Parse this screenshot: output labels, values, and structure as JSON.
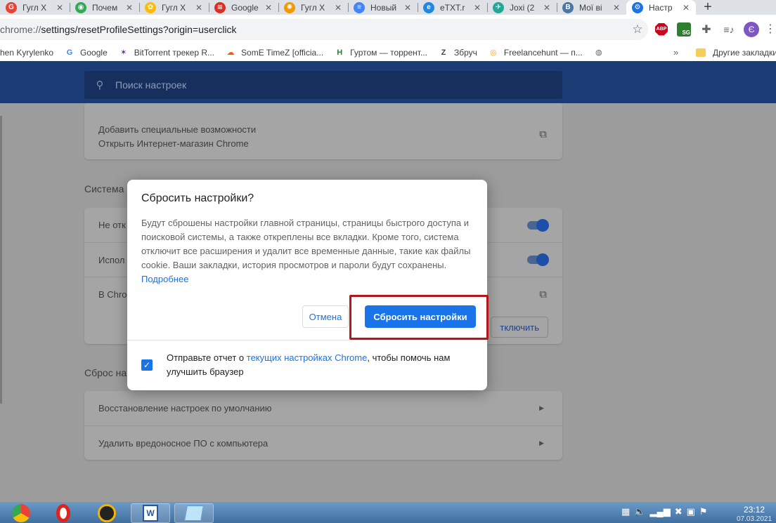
{
  "tabs": [
    {
      "title": "Гугл Х",
      "icon": "google-tab-icon",
      "color": "#ea4335",
      "glyph": "G"
    },
    {
      "title": "Почем",
      "icon": "chrome-tab-icon",
      "color": "#34a853",
      "glyph": "◉"
    },
    {
      "title": "Гугл Х",
      "icon": "google-photos-tab-icon",
      "color": "#fbbc05",
      "glyph": "✿"
    },
    {
      "title": "Google",
      "icon": "wifi-tab-icon",
      "color": "#d93025",
      "glyph": "≋"
    },
    {
      "title": "Гугл Х",
      "icon": "orange-tab-icon",
      "color": "#f29900",
      "glyph": "✺"
    },
    {
      "title": "Новый",
      "icon": "docs-tab-icon",
      "color": "#4285f4",
      "glyph": "≡"
    },
    {
      "title": "eTXT.r",
      "icon": "etxt-tab-icon",
      "color": "#1e88e5",
      "glyph": "e"
    },
    {
      "title": "Joxi (2",
      "icon": "joxi-tab-icon",
      "color": "#26a69a",
      "glyph": "✈"
    },
    {
      "title": "Мої ві",
      "icon": "vk-tab-icon",
      "color": "#4a76a8",
      "glyph": "В"
    },
    {
      "title": "Настр",
      "icon": "settings-gear-tab-icon",
      "color": "#1a73e8",
      "glyph": "⚙",
      "active": true
    }
  ],
  "omnibox": {
    "url_prefix": "chrome://",
    "url_rest": "settings/resetProfileSettings?origin=userclick"
  },
  "toolbar": {
    "avatar_letter": "Є",
    "abp": "ABP",
    "sg": "SG"
  },
  "bookmarks": [
    {
      "label": "hen Kyrylenko",
      "icon": "",
      "color": "#ffffff"
    },
    {
      "label": "Google",
      "icon": "google-bookmark-icon",
      "color": "#4285f4",
      "glyph": "G"
    },
    {
      "label": "BitTorrent трекер R...",
      "icon": "bittorrent-bookmark-icon",
      "color": "#7b1fa2",
      "glyph": "✶"
    },
    {
      "label": "SomE TimeZ [officia...",
      "icon": "soundcloud-bookmark-icon",
      "color": "#ff5500",
      "glyph": "☁"
    },
    {
      "label": "Гуртом — торрент...",
      "icon": "hurtom-bookmark-icon",
      "color": "#2e7d32",
      "glyph": "H"
    },
    {
      "label": "Збруч",
      "icon": "zbruch-bookmark-icon",
      "color": "#37474f",
      "glyph": "Z"
    },
    {
      "label": "Freelancehunt — п...",
      "icon": "freelancehunt-bookmark-icon",
      "color": "#f9a825",
      "glyph": "◎"
    },
    {
      "label": "",
      "icon": "globe-bookmark-icon",
      "color": "#5f6368",
      "glyph": "◍"
    }
  ],
  "bookmarks_more": "»",
  "other_bookmarks": "Другие закладки",
  "search": {
    "placeholder": "Поиск настроек"
  },
  "page": {
    "accessibility_title": "Добавить специальные возможности",
    "accessibility_sub": "Открыть Интернет-магазин Chrome",
    "system_section": "Система",
    "system_row1": "Не отк",
    "system_row2": "Испол",
    "system_row3": "В Chro",
    "disable_btn": "тключить",
    "reset_section": "Сброс на",
    "reset_row1": "Восстановление настроек по умолчанию",
    "reset_row2": "Удалить вредоносное ПО с компьютера"
  },
  "dialog": {
    "title": "Сбросить настройки?",
    "body": "Будут сброшены настройки главной страницы, страницы быстрого доступа и поисковой системы, а также откреплены все вкладки. Кроме того, система отключит все расширения и удалит все временные данные, такие как файлы cookie. Ваши закладки, история просмотров и пароли будут сохранены.",
    "learn_more": "Подробнее",
    "cancel": "Отмена",
    "reset": "Сбросить настройки",
    "report_prefix": "Отправьте отчет о ",
    "report_link": "текущих настройках Chrome",
    "report_suffix": ", чтобы помочь нам улучшить браузер",
    "report_checked": true
  },
  "taskbar": {
    "time": "23:12",
    "date": "07.03.2021"
  }
}
